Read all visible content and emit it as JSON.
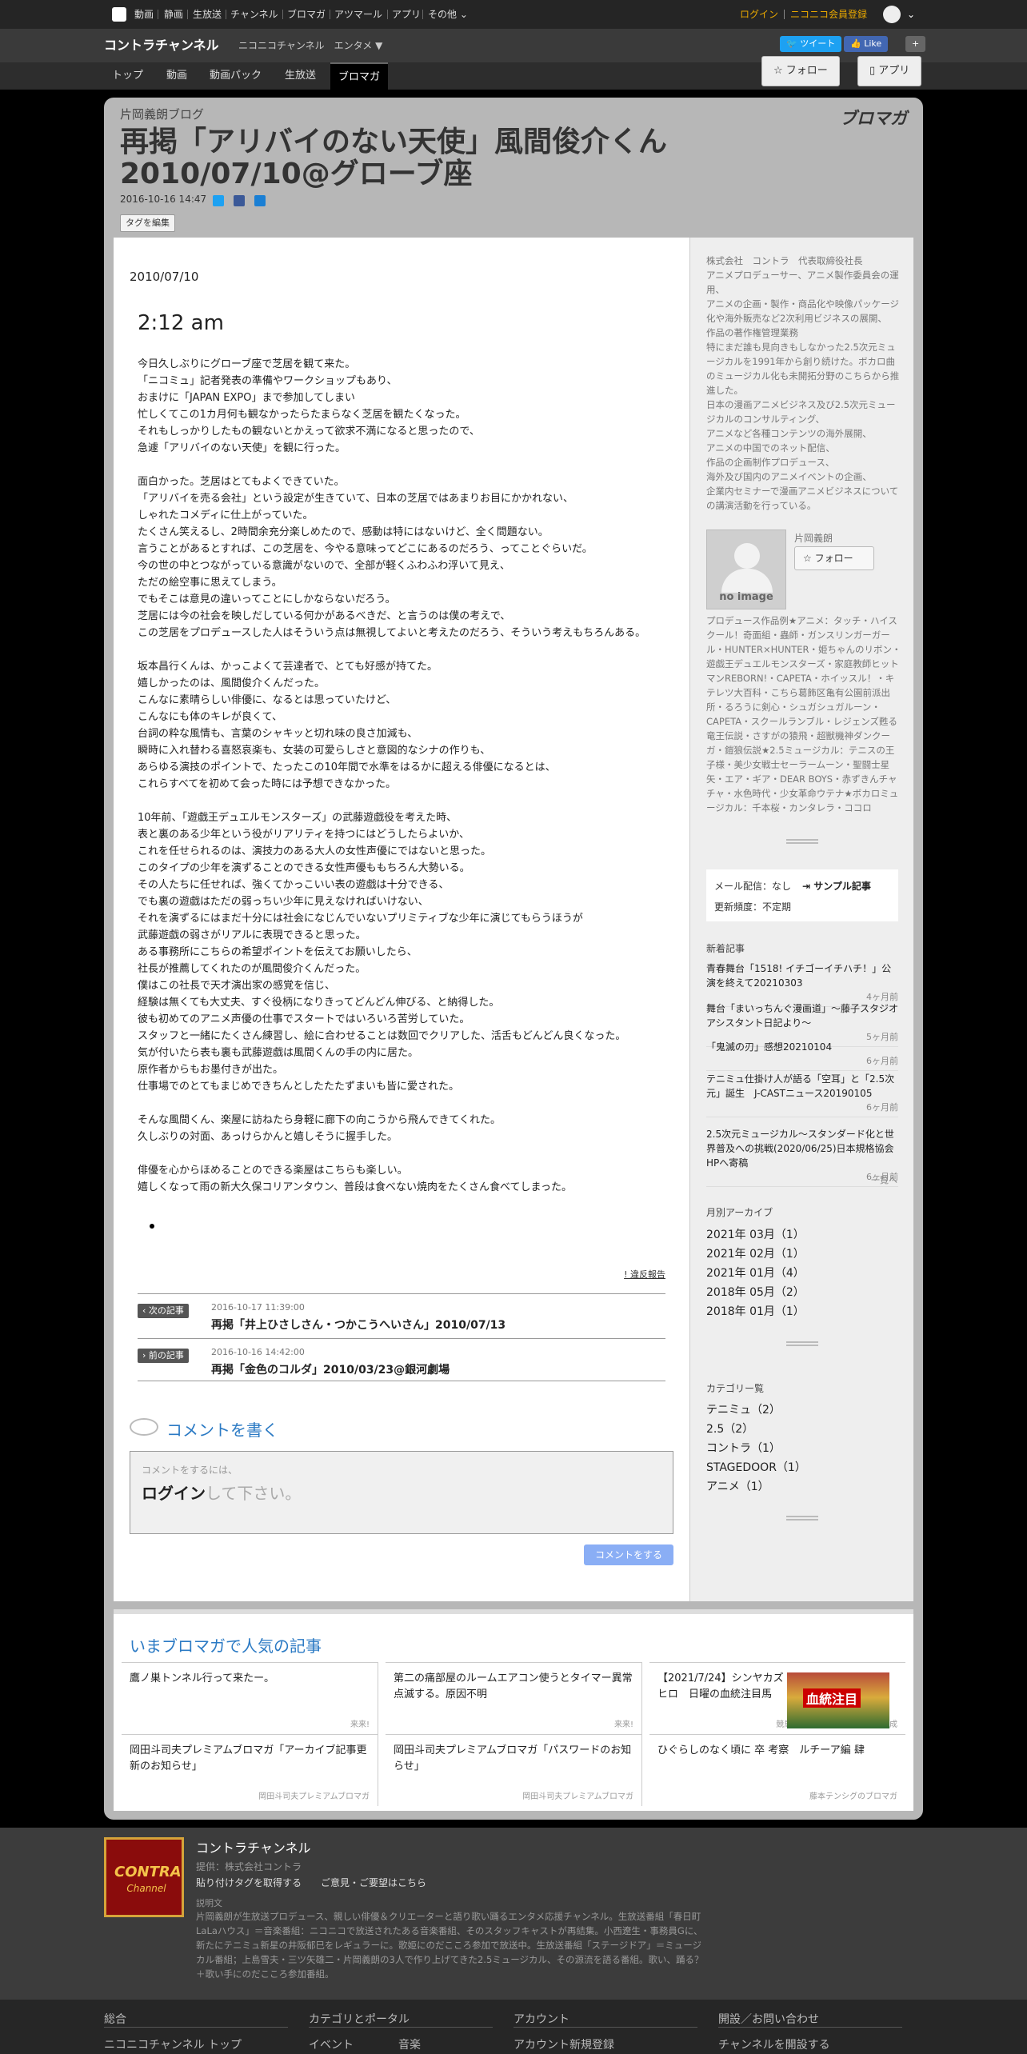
{
  "gnav": {
    "items": [
      "動画",
      "静画",
      "生放送",
      "チャンネル",
      "ブロマガ",
      "アツマール",
      "アプリ",
      "その他"
    ],
    "login": "ログイン",
    "register": "ニコニコ会員登録"
  },
  "channel": {
    "title": "コントラチャンネル",
    "provider": "ニコニコチャンネル",
    "genre": "エンタメ ▼",
    "tweet": "ツイート",
    "like": "Like",
    "follow": "フォロー",
    "app": "アプリ",
    "tabs": [
      "トップ",
      "動画",
      "動画パック",
      "生放送",
      "ブロマガ"
    ]
  },
  "article": {
    "blog_name": "片岡義朗ブログ",
    "title": "再掲「アリバイのない天使」風間俊介くん 2010/07/10@グローブ座",
    "posted": "2016-10-16 14:47",
    "tag_edit": "タグを編集",
    "blomaga": "ブロマガ",
    "date": "2010/07/10",
    "time": "2:12 am",
    "paragraphs": [
      [
        "今日久しぶりにグローブ座で芝居を観て来た。",
        "「ニコミュ」記者発表の準備やワークショップもあり、",
        "おまけに「JAPAN EXPO」まで参加してしまい",
        "忙しくてこの1カ月何も観なかったらたまらなく芝居を観たくなった。",
        "それもしっかりしたもの観ないとかえって欲求不満になると思ったので、",
        "急遽「アリバイのない天使」を観に行った。"
      ],
      [
        "面白かった。芝居はとてもよくできていた。",
        "「アリバイを売る会社」という設定が生きていて、日本の芝居ではあまりお目にかかれない、",
        "しゃれたコメディに仕上がっていた。",
        "たくさん笑えるし、2時間余充分楽しめたので、感動は特にはないけど、全く問題ない。",
        "言うことがあるとすれば、この芝居を、今やる意味ってどこにあるのだろう、ってことぐらいだ。",
        "今の世の中とつながっている意識がないので、全部が軽くふわふわ浮いて見え、",
        "ただの絵空事に思えてしまう。",
        "でもそこは意見の違いってことにしかならないだろう。",
        "芝居には今の社会を映しだしている何かがあるべきだ、と言うのは僕の考えで、",
        "この芝居をプロデュースした人はそういう点は無視してよいと考えたのだろう、そういう考えもちろんある。"
      ],
      [
        "坂本昌行くんは、かっこよくて芸達者で、とても好感が持てた。",
        "嬉しかったのは、風間俊介くんだった。",
        "こんなに素晴らしい俳優に、なるとは思っていたけど、",
        "こんなにも体のキレが良くて、",
        "台詞の粋な風情も、言葉のシャキッと切れ味の良さ加減も、",
        "瞬時に入れ替わる喜怒哀楽も、女装の可愛らしさと意図的なシナの作りも、",
        "あらゆる演技のポイントで、たったこの10年間で水準をはるかに超える俳優になるとは、",
        "これらすべてを初めて会った時には予想できなかった。"
      ],
      [
        "10年前、「遊戯王デュエルモンスターズ」の武藤遊戯役を考えた時、",
        "表と裏のある少年という役がリアリティを持つにはどうしたらよいか、",
        "これを任せられるのは、演技力のある大人の女性声優にではないと思った。",
        "このタイプの少年を演ずることのできる女性声優ももちろん大勢いる。",
        "その人たちに任せれば、強くてかっこいい表の遊戯は十分できる、",
        "でも裏の遊戯はただの弱っちい少年に見えなければいけない、",
        "それを演ずるにはまだ十分には社会になじんでいないプリミティブな少年に演じてもらうほうが",
        "武藤遊戯の弱さがリアルに表現できると思った。",
        "ある事務所にこちらの希望ポイントを伝えてお願いしたら、",
        "社長が推薦してくれたのが風間俊介くんだった。",
        "僕はこの社長で天才演出家の感覚を信じ、",
        "経験は無くても大丈夫、すぐ役柄になりきってどんどん伸びる、と納得した。",
        "彼も初めてのアニメ声優の仕事でスタートではいろいろ苦労していた。",
        "スタッフと一緒にたくさん練習し、絵に合わせることは数回でクリアした、活舌もどんどん良くなった。",
        "気が付いたら表も裏も武藤遊戯は風間くんの手の内に居た。",
        "原作者からもお墨付きが出た。",
        "仕事場でのとてもまじめできちんとしたたたずまいも皆に愛された。"
      ],
      [
        "そんな風間くん、楽屋に訪ねたら身軽に廊下の向こうから飛んできてくれた。",
        "久しぶりの対面、あっけらかんと嬉しそうに握手した。"
      ],
      [
        "俳優を心からほめることのできる楽屋はこちらも楽しい。",
        "嬉しくなって雨の新大久保コリアンタウン、普段は食べない焼肉をたくさん食べてしまった。"
      ]
    ],
    "report": "! 違反報告",
    "next": {
      "label": "次の記事",
      "date": "2016-10-17 11:39:00",
      "title": "再掲「井上ひさしさん・つかこうへいさん」2010/07/13"
    },
    "prev": {
      "label": "前の記事",
      "date": "2016-10-16 14:42:00",
      "title": "再掲「金色のコルダ」2010/03/23@銀河劇場"
    },
    "comment": {
      "heading": "コメントを書く",
      "ph1": "コメントをするには、",
      "ph_login": "ログイン",
      "ph_rest": "して下さい。",
      "button": "コメントをする"
    }
  },
  "side": {
    "desc": [
      "株式会社　コントラ　代表取締役社長",
      "アニメプロデューサー、アニメ製作委員会の運用、",
      "アニメの企画・製作・商品化や映像パッケージ化や海外販売など2次利用ビジネスの展開、",
      "作品の著作権管理業務",
      "特にまだ誰も見向きもしなかった2.5次元ミュージカルを1991年から創り続けた。ボカロ曲のミュージカル化も未開拓分野のこちらから推進した。",
      "日本の漫画アニメビジネス及び2.5次元ミュージカルのコンサルティング、",
      "アニメなど各種コンテンツの海外展開、",
      "アニメの中国でのネット配信、",
      "作品の企画制作プロデュース、",
      "海外及び国内のアニメイベントの企画、",
      "企業内セミナーで漫画アニメビジネスについての講演活動を行っている。"
    ],
    "noimage": "no image",
    "owner": "片岡義朗",
    "follow": "フォロー",
    "works": "プロデュース作品例★アニメ：タッチ・ハイスクール！奇面組・蟲師・ガンスリンガーガール・HUNTER×HUNTER・姫ちゃんのリボン・遊戯王デュエルモンスターズ・家庭教師ヒットマンREBORN!・CAPETA・ホイッスル！・キテレツ大百科・こちら葛飾区亀有公園前派出所・るろうに剣心・シュガシュガルーン・CAPETA・スクールランブル・レジェンズ甦る竜王伝説・さすがの猿飛・超獣機神ダンクーガ・鎧狼伝説★2.5ミュージカル：テニスの王子様・美少女戦士セーラームーン・聖闘士星矢・エア・ギア・DEAR BOYS・赤ずきんチャチャ・水色時代・少女革命ウテナ★ボカロミュージカル：千本桜・カンタレラ・ココロ",
    "mail_label": "メール配信：なし",
    "sample": "サンプル記事",
    "freq": "更新頻度：不定期",
    "news_h": "新着記事",
    "news": [
      {
        "t": "青春舞台「1518! イチゴーイチハチ！」公演を終えて20210303",
        "w": "4ヶ月前"
      },
      {
        "t": "舞台「まいっちんぐ漫画道」～藤子スタジオアシスタント日記より～",
        "w": "5ヶ月前"
      },
      {
        "t": "「鬼滅の刃」感想20210104",
        "w": "6ヶ月前"
      },
      {
        "t": "テニミュ仕掛け人が語る「空耳」と「2.5次元」誕生　J-CASTニュース20190105",
        "w": "6ヶ月前"
      },
      {
        "t": "2.5次元ミュージカル～スタンダード化と世界普及への挑戦(2020/06/25)日本規格協会HPへ寄稿",
        "w": "6ヶ月前"
      }
    ],
    "more": "一覧へ",
    "archive_h": "月別アーカイブ",
    "archive": [
      "2021年 03月（1）",
      "2021年 02月（1）",
      "2021年 01月（4）",
      "2018年 05月（2）",
      "2018年 01月（1）"
    ],
    "cat_h": "カテゴリー覧",
    "cats": [
      "テニミュ（2）",
      "2.5（2）",
      "コントラ（1）",
      "STAGEDOOR（1）",
      "アニメ（1）"
    ]
  },
  "popular": {
    "title": "いまブロマガで人気の記事",
    "cards": [
      {
        "t": "鷹ノ巣トンネル行って来たー。",
        "s": "来来!"
      },
      {
        "t": "第二の痛部屋のルームエアコン使うとタイマー異常点滅する。原因不明",
        "s": "来来!"
      },
      {
        "t": "【2021/7/24】シンヤカズヒロ　日曜の血統注目馬",
        "s": "競馬王Webマガジン－競馬理の成"
      },
      {
        "t": "岡田斗司夫プレミアムブロマガ「アーカイブ記事更新のお知らせ」",
        "s": "岡田斗司夫プレミアムブロマガ"
      },
      {
        "t": "岡田斗司夫プレミアムブロマガ「パスワードのお知らせ」",
        "s": "岡田斗司夫プレミアムブロマガ"
      },
      {
        "t": "ひぐらしのなく頃に 卒 考察　ルチーア編 肆",
        "s": "藤本テンシグのブロマガ"
      }
    ],
    "thumb_text": "血統注目"
  },
  "footer": {
    "name": "コントラチャンネル",
    "provider": "提供：株式会社コントラ",
    "links": "貼り付けタグを取得する　　ご意見・ご要望はこちら",
    "exp_label": "説明文",
    "exp": "片岡義朗が生放送プロデュース、親しい俳優＆クリエーターと語り歌い踊るエンタメ応援チャンネル。生放送番組「春日町LaLaハウス」＝音楽番組：ニコニコで放送されたある音楽番組、そのスタッフキャストが再結集。小西遼生・事務員Gに、新たにテニミュ新星の井阪郁巳をレギュラーに。歌姫にのだこころ参加で放送中。生放送番組「ステージドア」＝ミュージカル番組；上島雪夫・三ツ矢雄二・片岡義朗の3人で作り上げてきた2.5ミュージカル、その源流を語る番組。歌い、踊る？＋歌い手にのだこころ参加番組。",
    "logo1": "CONTRA",
    "logo2": "Channel"
  },
  "gfoot": {
    "cols": [
      {
        "h": "総合",
        "i": "ニコニコチャンネル トップ"
      },
      {
        "h": "カテゴリとポータル",
        "i": "イベント　　　　音楽"
      },
      {
        "h": "アカウント",
        "i": "アカウント新規登録"
      },
      {
        "h": "開設／お問い合わせ",
        "i": "チャンネルを開設する"
      }
    ]
  },
  "colors": {
    "accent": "#2b7ac4",
    "gold": "#e9a800",
    "comment_btn": "#8aaef5"
  }
}
